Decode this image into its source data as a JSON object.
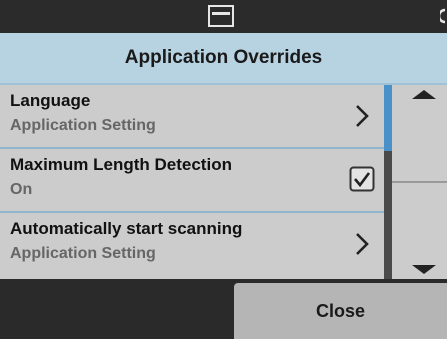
{
  "header": {
    "title": "Application Overrides"
  },
  "settings": [
    {
      "label": "Language",
      "value": "Application Setting",
      "control": "chevron-right-icon"
    },
    {
      "label": "Maximum Length Detection",
      "value": "On",
      "control": "checkbox-checked-icon",
      "checked": true
    },
    {
      "label": "Automatically start scanning",
      "value": "Application Setting",
      "control": "chevron-right-icon"
    }
  ],
  "footer": {
    "close_label": "Close"
  },
  "colors": {
    "title_bar": "#b7d3e2",
    "row_bg": "#cccccc",
    "divider": "#8fb7cc",
    "scroll_thumb": "#4a90c9",
    "background": "#2a2a2a",
    "button_bg": "#b5b5b5"
  }
}
